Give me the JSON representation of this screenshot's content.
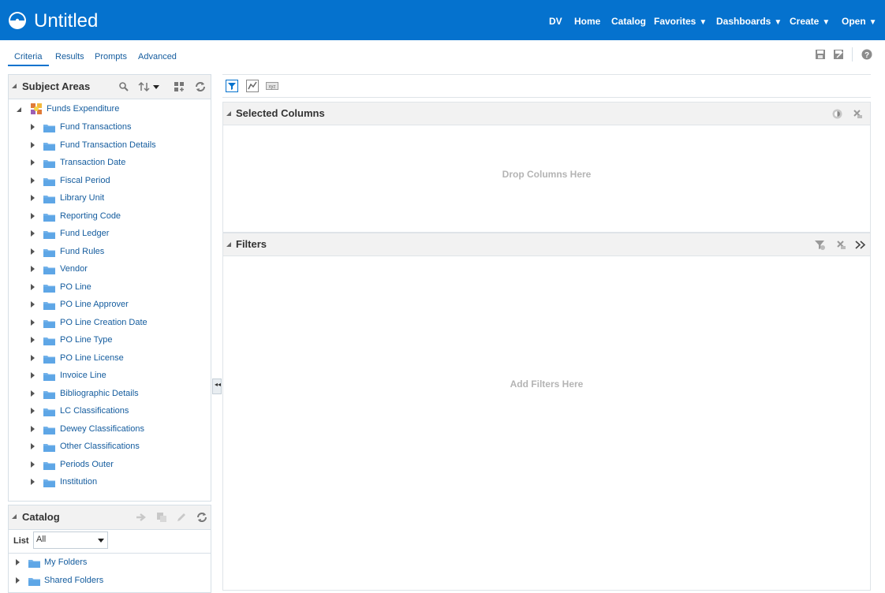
{
  "colors": {
    "brand_bar": "#0572ce",
    "link": "#145c9e",
    "panel_header": "#f2f2f2",
    "border": "#d6dfe6",
    "folder": "#74b3ea",
    "placeholder_text": "#b4b4b4"
  },
  "header": {
    "title": "Untitled",
    "logo_icon": "analytics-logo-icon",
    "nav": [
      {
        "label": "DV",
        "has_menu": false
      },
      {
        "label": "Home",
        "has_menu": false
      },
      {
        "label": "Catalog",
        "has_menu": false
      },
      {
        "label": "Favorites",
        "has_menu": true
      },
      {
        "label": "Dashboards",
        "has_menu": true
      },
      {
        "label": "Create",
        "has_menu": true
      },
      {
        "label": "Open",
        "has_menu": true
      }
    ],
    "caret": "▼"
  },
  "tabs": [
    {
      "label": "Criteria",
      "active": true
    },
    {
      "label": "Results",
      "active": false
    },
    {
      "label": "Prompts",
      "active": false
    },
    {
      "label": "Advanced",
      "active": false
    }
  ],
  "subject_areas": {
    "title": "Subject Areas",
    "root": "Funds Expenditure",
    "folders": [
      "Fund Transactions",
      "Fund Transaction Details",
      "Transaction Date",
      "Fiscal Period",
      "Library Unit",
      "Reporting Code",
      "Fund Ledger",
      "Fund Rules",
      "Vendor",
      "PO Line",
      "PO Line Approver",
      "PO Line Creation Date",
      "PO Line Type",
      "PO Line License",
      "Invoice Line",
      "Bibliographic Details",
      "LC Classifications",
      "Dewey Classifications",
      "Other Classifications",
      "Periods Outer",
      "Institution"
    ]
  },
  "catalog": {
    "title": "Catalog",
    "list_label": "List",
    "list_value": "All",
    "folders": [
      "My Folders",
      "Shared Folders"
    ]
  },
  "selected_columns": {
    "title": "Selected Columns",
    "placeholder": "Drop Columns Here"
  },
  "filters": {
    "title": "Filters",
    "placeholder": "Add Filters Here"
  }
}
